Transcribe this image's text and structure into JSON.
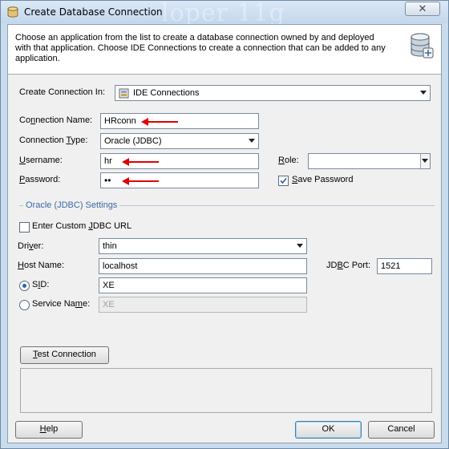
{
  "window": {
    "title": "Create Database Connection",
    "watermark": "loper 11g",
    "close_glyph": "✕"
  },
  "header": {
    "description": "Choose an application from the list to create a database connection owned by and deployed with that application. Choose IDE Connections to create a connection that can be added to any application."
  },
  "form": {
    "create_in_label": "Create Connection In:",
    "create_in_value": "IDE Connections",
    "connection_name_label": "Connection Name:",
    "connection_name_value": "HRconn",
    "connection_type_label": "Connection Type:",
    "connection_type_value": "Oracle (JDBC)",
    "username_label": "Username:",
    "username_value": "hr",
    "password_label": "Password:",
    "password_value": "••",
    "role_label": "Role:",
    "role_value": "",
    "save_password_label": "Save Password",
    "save_password_checked": true
  },
  "oracle_settings": {
    "section_title": "Oracle (JDBC) Settings",
    "custom_url_label": "Enter Custom JDBC URL",
    "custom_url_checked": false,
    "driver_label": "Driver:",
    "driver_value": "thin",
    "host_label": "Host Name:",
    "host_value": "localhost",
    "port_label": "JDBC Port:",
    "port_value": "1521",
    "sid_label": "SID:",
    "sid_value": "XE",
    "sid_selected": true,
    "service_label": "Service Name:",
    "service_value": "XE"
  },
  "buttons": {
    "test_connection": "Test Connection",
    "help": "Help",
    "ok": "OK",
    "cancel": "Cancel"
  },
  "colors": {
    "arrow": "#e00000",
    "section": "#3a6aa6"
  }
}
